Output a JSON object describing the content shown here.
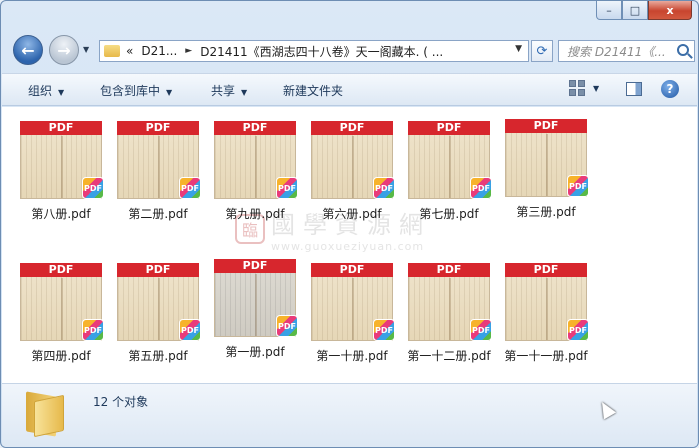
{
  "window": {
    "caption_buttons": [
      "–",
      "□",
      "x"
    ]
  },
  "nav": {
    "back_icon": "←",
    "forward_icon": "→",
    "breadcrumb": {
      "prefix": "«",
      "segments": [
        "D21...",
        "D21411《西湖志四十八卷》天一阁藏本. ( ..."
      ],
      "separator": "►"
    },
    "refresh_icon": "⟳",
    "search": {
      "placeholder": "搜索 D21411《..."
    }
  },
  "toolbar": {
    "organize": "组织",
    "include_library": "包含到库中",
    "share": "共享",
    "new_folder": "新建文件夹"
  },
  "files": [
    {
      "name": "第八册.pdf",
      "banner": "PDF",
      "badge": "PDF"
    },
    {
      "name": "第二册.pdf",
      "banner": "PDF",
      "badge": "PDF"
    },
    {
      "name": "第九册.pdf",
      "banner": "PDF",
      "badge": "PDF"
    },
    {
      "name": "第六册.pdf",
      "banner": "PDF",
      "badge": "PDF"
    },
    {
      "name": "第七册.pdf",
      "banner": "PDF",
      "badge": "PDF"
    },
    {
      "name": "第三册.pdf",
      "banner": "PDF",
      "badge": "PDF"
    },
    {
      "name": "第四册.pdf",
      "banner": "PDF",
      "badge": "PDF"
    },
    {
      "name": "第五册.pdf",
      "banner": "PDF",
      "badge": "PDF"
    },
    {
      "name": "第一册.pdf",
      "banner": "PDF",
      "badge": "PDF"
    },
    {
      "name": "第一十册.pdf",
      "banner": "PDF",
      "badge": "PDF"
    },
    {
      "name": "第一十二册.pdf",
      "banner": "PDF",
      "badge": "PDF"
    },
    {
      "name": "第一十一册.pdf",
      "banner": "PDF",
      "badge": "PDF"
    }
  ],
  "watermark": {
    "seal": "臨",
    "chinese": "國學資源網",
    "url": "www.guoxueziyuan.com"
  },
  "status": {
    "count": "12 个对象"
  }
}
